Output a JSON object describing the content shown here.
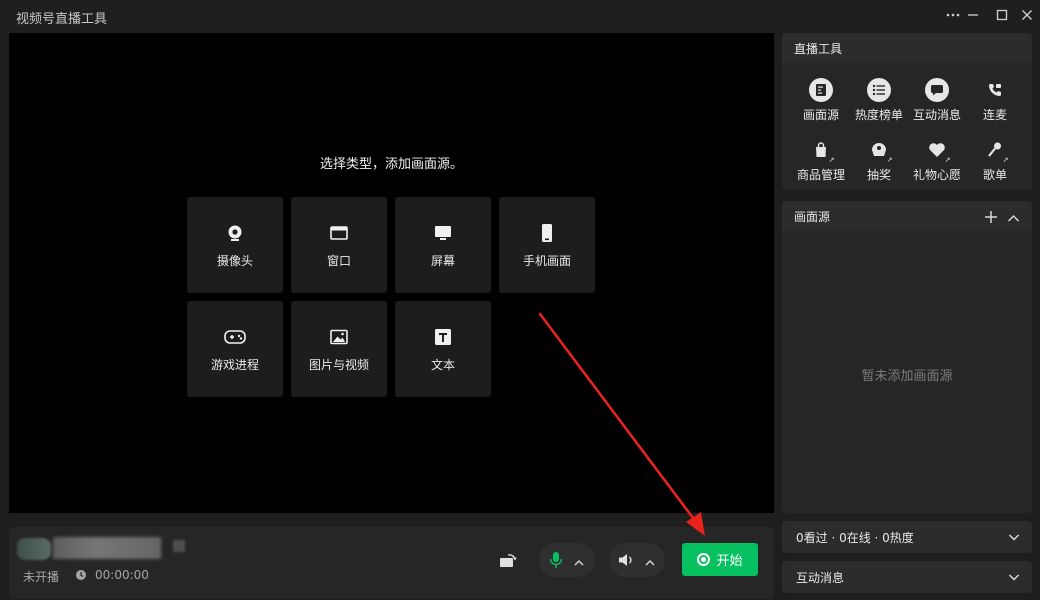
{
  "app": {
    "title": "视频号直播工具"
  },
  "window_controls": [
    "more-icon",
    "minimize-icon",
    "maximize-icon",
    "close-icon"
  ],
  "stage": {
    "prompt": "选择类型，添加画面源。",
    "sources": [
      {
        "label": "摄像头",
        "icon": "camera-icon"
      },
      {
        "label": "窗口",
        "icon": "window-icon"
      },
      {
        "label": "屏幕",
        "icon": "monitor-icon"
      },
      {
        "label": "手机画面",
        "icon": "phone-icon"
      },
      {
        "label": "游戏进程",
        "icon": "gamepad-icon"
      },
      {
        "label": "图片与视频",
        "icon": "image-icon"
      },
      {
        "label": "文本",
        "icon": "text-icon"
      }
    ]
  },
  "bottombar": {
    "status": "未开播",
    "timer": "00:00:00",
    "start_label": "开始"
  },
  "tools_panel": {
    "title": "直播工具",
    "items": [
      {
        "label": "画面源",
        "icon": "source-icon"
      },
      {
        "label": "热度榜单",
        "icon": "list-icon"
      },
      {
        "label": "互动消息",
        "icon": "chat-icon"
      },
      {
        "label": "连麦",
        "icon": "call-icon"
      },
      {
        "label": "商品管理",
        "icon": "shopping-bag-icon"
      },
      {
        "label": "抽奖",
        "icon": "lottery-icon"
      },
      {
        "label": "礼物心愿",
        "icon": "gift-heart-icon"
      },
      {
        "label": "歌单",
        "icon": "music-mic-icon"
      }
    ]
  },
  "sources_panel": {
    "title": "画面源",
    "empty": "暂未添加画面源"
  },
  "stats_panel": {
    "label": "0看过 · 0在线 · 0热度"
  },
  "messages_panel": {
    "label": "互动消息"
  },
  "colors": {
    "accent": "#07c160",
    "background": "#1e1e1e",
    "stage": "#000000",
    "annotation_arrow": "#e8231f"
  }
}
